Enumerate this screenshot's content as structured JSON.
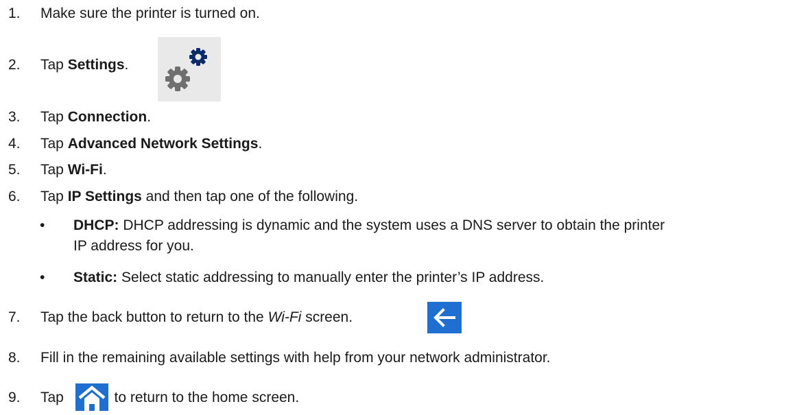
{
  "steps": [
    {
      "num": "1.",
      "text": "Make sure the printer is turned on."
    },
    {
      "num": "2.",
      "pre": "Tap ",
      "bold": "Settings",
      "post": "."
    },
    {
      "num": "3.",
      "pre": "Tap ",
      "bold": "Connection",
      "post": "."
    },
    {
      "num": "4.",
      "pre": "Tap ",
      "bold": "Advanced Network Settings",
      "post": "."
    },
    {
      "num": "5.",
      "pre": "Tap ",
      "bold": "Wi-Fi",
      "post": "."
    },
    {
      "num": "6.",
      "pre": "Tap ",
      "bold": "IP Settings",
      "post": " and then tap one of the following."
    },
    {
      "num": "7.",
      "pre": "Tap the back button to return to the ",
      "italic": "Wi-Fi",
      "post": " screen."
    },
    {
      "num": "8.",
      "text": "Fill in the remaining available settings with help from your network administrator."
    },
    {
      "num": "9.",
      "pre": "Tap ",
      "post": " to return to the home screen."
    }
  ],
  "bullets": [
    {
      "bold": "DHCP:",
      "line1": " DHCP addressing is dynamic and the system uses a DNS server to obtain the printer",
      "line2": "IP address for you."
    },
    {
      "bold": "Static:",
      "line1": " Select static addressing to manually enter the printer’s IP address."
    }
  ],
  "bullet_char": "•",
  "icons": {
    "settings": "settings-gears-icon",
    "back": "back-arrow-icon",
    "home": "home-icon"
  },
  "colors": {
    "icon_blue": "#1e6fd0",
    "gear_dark": "#0b2a68",
    "gear_gray": "#6f6f6f",
    "icon_bg": "#e9e9e9"
  }
}
